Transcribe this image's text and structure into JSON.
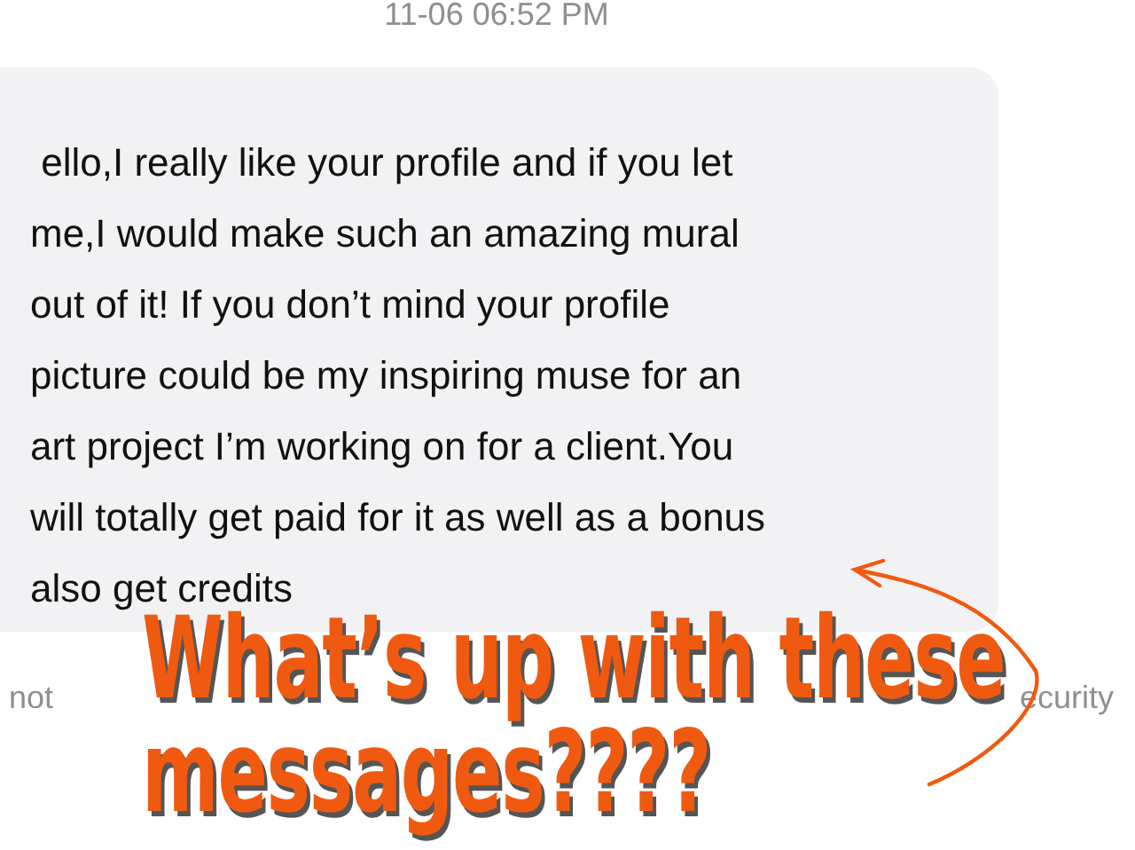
{
  "timestamp": "11-06 06:52 PM",
  "message": {
    "text": " ello,I really like your profile and if you let\nme,I would make such an amazing mural\nout of it! If you don’t mind your profile\npicture could be my inspiring muse for an\nart project I’m working on for a client.You\nwill totally get paid for it as well as a bonus\nalso get credits"
  },
  "notice": {
    "fragments": [
      "not",
      "ecurity"
    ]
  },
  "overlay": {
    "lines": [
      "What’s up with these",
      "messages????"
    ]
  }
}
